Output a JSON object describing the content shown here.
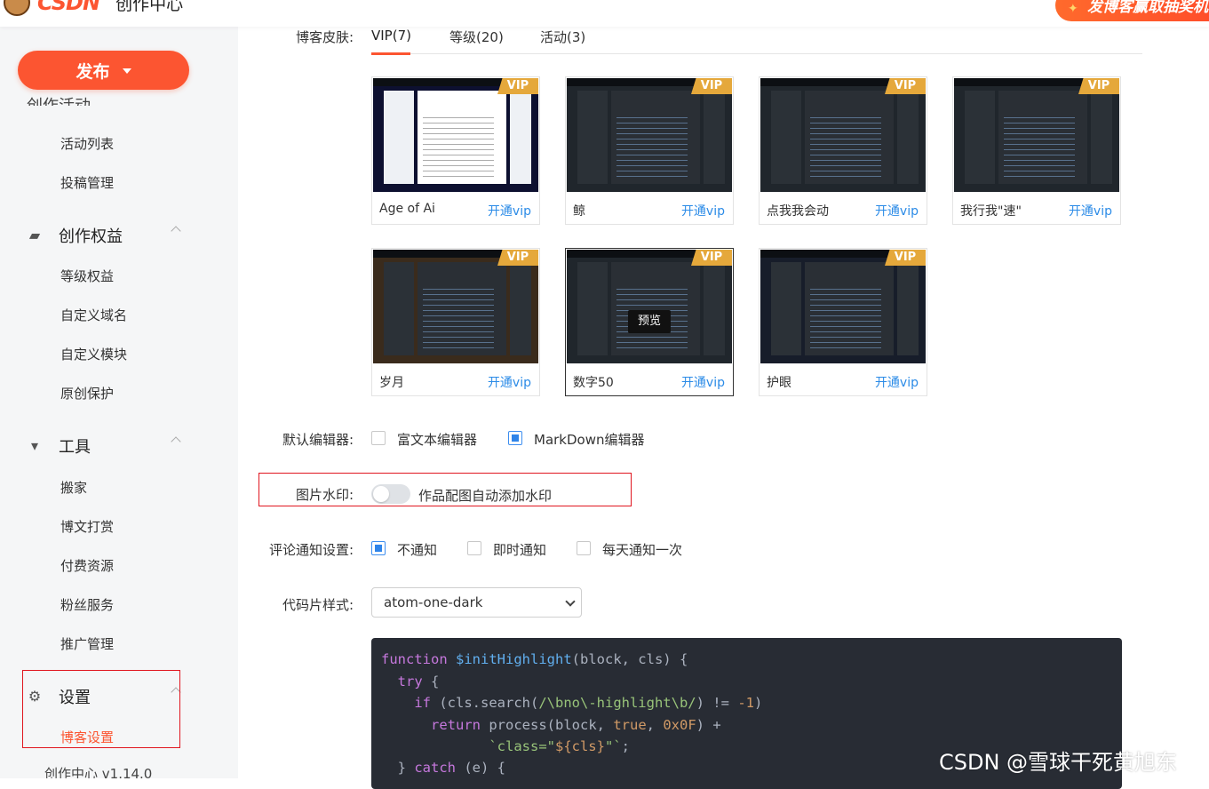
{
  "header": {
    "brand": "CSDN",
    "centre_title": "创作中心",
    "promo_text": "发博客赢取抽奖机会"
  },
  "sidebar": {
    "publish_label": "发布",
    "cut_group_label": "创作活动",
    "items_top": [
      {
        "label": "活动列表"
      },
      {
        "label": "投稿管理"
      }
    ],
    "group_rights": {
      "label": "创作权益",
      "icon": "wallet-icon"
    },
    "items_rights": [
      {
        "label": "等级权益"
      },
      {
        "label": "自定义域名"
      },
      {
        "label": "自定义模块"
      },
      {
        "label": "原创保护"
      }
    ],
    "group_tools": {
      "label": "工具",
      "icon": "brush-icon"
    },
    "items_tools": [
      {
        "label": "搬家"
      },
      {
        "label": "博文打赏"
      },
      {
        "label": "付费资源"
      },
      {
        "label": "粉丝服务"
      },
      {
        "label": "推广管理"
      }
    ],
    "group_settings": {
      "label": "设置",
      "icon": "gear-icon"
    },
    "item_settings_active": "博客设置",
    "version": "创作中心 v1.14.0"
  },
  "skins": {
    "label": "博客皮肤:",
    "tabs": [
      {
        "label": "VIP(7)"
      },
      {
        "label": "等级(20)"
      },
      {
        "label": "活动(3)"
      }
    ],
    "vip_badge": "VIP",
    "open_label": "开通vip",
    "preview_label": "预览",
    "items": [
      {
        "name": "Age of Ai"
      },
      {
        "name": "鲸"
      },
      {
        "name": "点我我会动"
      },
      {
        "name": "我行我\"速\""
      },
      {
        "name": "岁月"
      },
      {
        "name": "数字50"
      },
      {
        "name": "护眼"
      }
    ]
  },
  "editor": {
    "label": "默认编辑器:",
    "options": [
      {
        "label": "富文本编辑器",
        "checked": false
      },
      {
        "label": "MarkDown编辑器",
        "checked": true
      }
    ]
  },
  "watermark_setting": {
    "label": "图片水印:",
    "toggle_text": "作品配图自动添加水印",
    "on": false
  },
  "comment_notify": {
    "label": "评论通知设置:",
    "options": [
      {
        "label": "不通知",
        "checked": true
      },
      {
        "label": "即时通知",
        "checked": false
      },
      {
        "label": "每天通知一次",
        "checked": false
      }
    ]
  },
  "code_style": {
    "label": "代码片样式:",
    "selected": "atom-one-dark"
  },
  "page_watermark": "CSDN @雪球干死黄旭东",
  "colors": {
    "brand": "#fc5531",
    "link": "#2b8be7",
    "vip_badge": "#e5a83b",
    "highlight_box": "#e0161f",
    "code_bg": "#282c34"
  }
}
